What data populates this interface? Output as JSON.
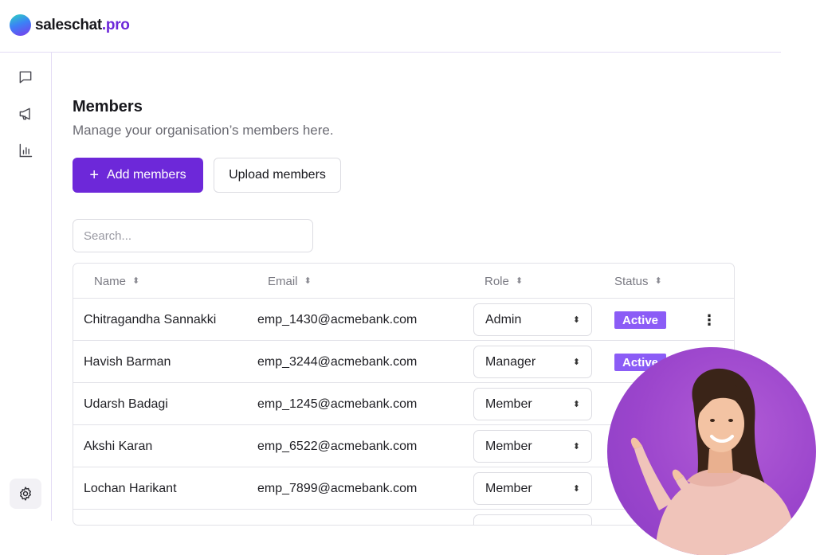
{
  "brand": {
    "name": "saleschat",
    "suffix": ".pro"
  },
  "icons": {
    "chat": "chat-bubble-icon",
    "campaign": "megaphone-icon",
    "analytics": "bar-chart-icon",
    "settings": "gear-icon"
  },
  "colors": {
    "accent": "#6d28d9",
    "badge": "#8b5cf6",
    "border": "#e2e2e8"
  },
  "page": {
    "title": "Members",
    "subtitle": "Manage your organisation’s members here.",
    "add_button": "Add members",
    "upload_button": "Upload members",
    "search_placeholder": "Search..."
  },
  "table": {
    "columns": [
      "Name",
      "Email",
      "Role",
      "Status"
    ],
    "rows": [
      {
        "name": "Chitragandha Sannakki",
        "email": "emp_1430@acmebank.com",
        "role": "Admin",
        "status": "Active"
      },
      {
        "name": "Havish Barman",
        "email": "emp_3244@acmebank.com",
        "role": "Manager",
        "status": "Active"
      },
      {
        "name": "Udarsh Badagi",
        "email": "emp_1245@acmebank.com",
        "role": "Member",
        "status": ""
      },
      {
        "name": "Akshi Karan",
        "email": "emp_6522@acmebank.com",
        "role": "Member",
        "status": ""
      },
      {
        "name": "Lochan Harikant",
        "email": "emp_7899@acmebank.com",
        "role": "Member",
        "status": ""
      }
    ]
  }
}
